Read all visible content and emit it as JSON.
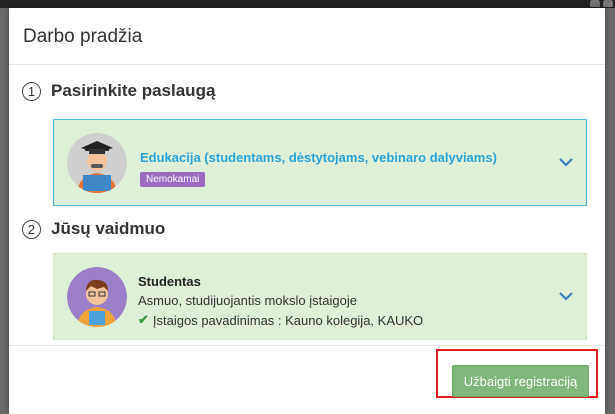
{
  "modal": {
    "title": "Darbo pradžia"
  },
  "steps": [
    {
      "number": "1",
      "title": "Pasirinkite paslaugą"
    },
    {
      "number": "2",
      "title": "Jūsų vaidmuo"
    }
  ],
  "service": {
    "name": "Edukacija (studentams, dėstytojams, vebinaro dalyviams)",
    "badge": "Nemokamai",
    "icon": "graduate-avatar-icon"
  },
  "role": {
    "name": "Studentas",
    "description": "Asmuo, studijuojantis mokslo įstaigoje",
    "institution": "Įstaigos pavadinimas : Kauno kolegija, KAUKO",
    "icon": "student-avatar-icon"
  },
  "footer": {
    "finish_label": "Užbaigti registraciją"
  },
  "colors": {
    "card_background": "#dff0d8",
    "service_border": "#4fb6df",
    "service_text": "#2aa2d6",
    "badge": "#9b6bc2",
    "button": "#80b77a",
    "highlight": "#e11d1d"
  }
}
